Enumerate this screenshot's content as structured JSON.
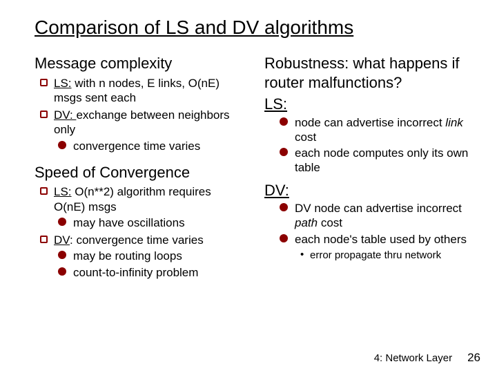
{
  "title": "Comparison of LS and DV algorithms",
  "left": {
    "h1": "Message complexity",
    "l11a": "LS:",
    "l11b": " with n nodes, E links, O(nE) msgs sent each",
    "l12a": "DV: ",
    "l12b": "exchange between neighbors only",
    "l12s1": "convergence time varies",
    "h2": "Speed of Convergence",
    "l21a": "LS:",
    "l21b": " O(n**2) algorithm requires O(nE) msgs",
    "l21s1": "may have oscillations",
    "l22a": "DV",
    "l22b": ": convergence time varies",
    "l22s1": "may be routing loops",
    "l22s2": "count-to-infinity problem"
  },
  "right": {
    "h1a": "Robustness:",
    "h1b": " what happens if router malfunctions?",
    "ls_label": "LS:",
    "ls1a": "node can advertise incorrect ",
    "ls1b": "link",
    "ls1c": " cost",
    "ls2": "each node computes only its own table",
    "dv_label": "DV:",
    "dv1a": "DV node can advertise incorrect ",
    "dv1b": "path",
    "dv1c": " cost",
    "dv2": "each node's table used by others",
    "dv2s1": "error propagate thru network"
  },
  "footer": {
    "section": "4: Network Layer",
    "page": "26"
  }
}
